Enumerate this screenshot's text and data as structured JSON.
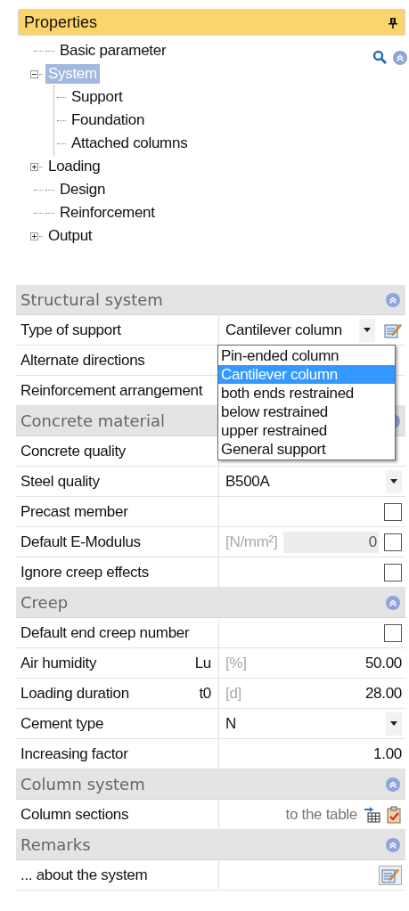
{
  "panel": {
    "title": "Properties"
  },
  "tree": [
    {
      "label": "Basic parameter",
      "selected": false
    },
    {
      "label": "System",
      "selected": true,
      "expanded": true,
      "children": [
        {
          "label": "Support",
          "selected": false
        },
        {
          "label": "Foundation",
          "selected": false
        },
        {
          "label": "Attached columns",
          "selected": false
        }
      ]
    },
    {
      "label": "Loading",
      "selected": false,
      "expanded": false
    },
    {
      "label": "Design",
      "selected": false
    },
    {
      "label": "Reinforcement",
      "selected": false
    },
    {
      "label": "Output",
      "selected": false,
      "expanded": false
    }
  ],
  "sections": [
    {
      "title": "Structural system",
      "rows": [
        {
          "label": "Type of support",
          "kind": "combo_edit",
          "value": "Cantilever column",
          "options": [
            {
              "label": "Pin-ended column",
              "selected": false
            },
            {
              "label": "Cantilever column",
              "selected": true
            },
            {
              "label": "both ends restrained",
              "selected": false
            },
            {
              "label": "below restrained",
              "selected": false
            },
            {
              "label": "upper restrained",
              "selected": false
            },
            {
              "label": "General support",
              "selected": false
            }
          ]
        },
        {
          "label": "Alternate directions",
          "kind": "empty"
        },
        {
          "label": "Reinforcement arrangement",
          "kind": "empty"
        }
      ]
    },
    {
      "title": "Concrete material",
      "rows": [
        {
          "label": "Concrete quality",
          "kind": "empty"
        },
        {
          "label": "Steel quality",
          "kind": "combo",
          "value": "B500A"
        },
        {
          "label": "Precast member",
          "kind": "check",
          "checked": false
        },
        {
          "label": "Default E-Modulus",
          "kind": "check",
          "unit": "[N/mm²]",
          "value": "0",
          "checked": false
        },
        {
          "label": "Ignore creep effects",
          "kind": "check",
          "checked": false
        }
      ]
    },
    {
      "title": "Creep",
      "rows": [
        {
          "label": "Default end creep number",
          "kind": "check",
          "checked": false
        },
        {
          "label": "Air humidity",
          "symbol": "Lu",
          "kind": "number",
          "unit": "[%]",
          "value": "50.00"
        },
        {
          "label": "Loading duration",
          "symbol": "t0",
          "kind": "number",
          "unit": "[d]",
          "value": "28.00"
        },
        {
          "label": "Cement type",
          "kind": "combo",
          "value": "N"
        },
        {
          "label": "Increasing factor",
          "kind": "number",
          "value": "1.00"
        }
      ]
    },
    {
      "title": "Column system",
      "rows": [
        {
          "label": "Column sections",
          "kind": "link",
          "value": "to the table"
        }
      ]
    },
    {
      "title": "Remarks",
      "rows": [
        {
          "label": "... about the system",
          "kind": "edit"
        }
      ]
    }
  ]
}
